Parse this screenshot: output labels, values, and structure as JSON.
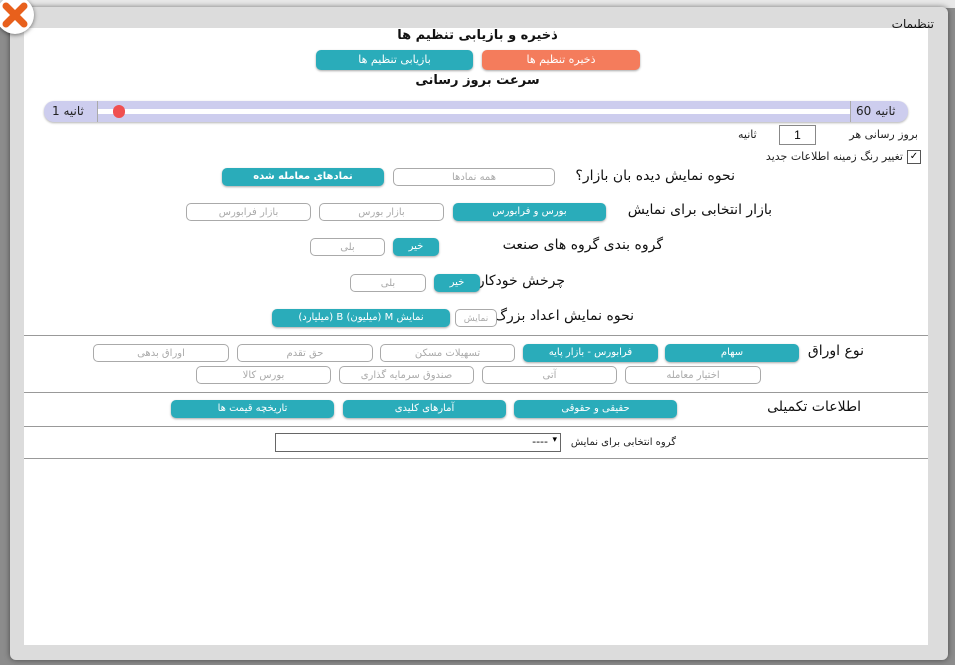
{
  "dialog": {
    "title": "تنظیمات"
  },
  "save_restore": {
    "heading": "ذخیره و بازیابی تنظیم ها",
    "save": "ذخیره تنظیم ها",
    "restore": "بازیابی تنظیم ها"
  },
  "refresh": {
    "heading": "سرعت بروز رسانی",
    "min_label": "ثانیه 1",
    "max_label": "ثانیه 60",
    "value_fraction": 0.02,
    "every_prefix": "بروز رسانی هر",
    "every_value": "1",
    "every_suffix": "ثانیه",
    "highlight_label": "تغییر رنگ زمینه اطلاعات جدید",
    "highlight_checked": true
  },
  "watch_mode": {
    "label": "نحوه نمایش دیده بان بازار؟",
    "options": [
      "همه نمادها",
      "نمادهای معامله شده"
    ],
    "selected": 1
  },
  "market": {
    "label": "بازار انتخابی برای نمایش",
    "options": [
      "بورس و فرابورس",
      "بازار بورس",
      "بازار فرابورس"
    ],
    "selected": 0
  },
  "grouping": {
    "label": "گروه بندی گروه های صنعت",
    "options": [
      "خیر",
      "بلی"
    ],
    "selected": 0
  },
  "autorotate": {
    "label": "چرخش خودکار",
    "options": [
      "خیر",
      "بلی"
    ],
    "selected": 0
  },
  "bignum": {
    "label": "نحوه نمایش اعداد بزرگ",
    "options": [
      "نمایش ساده",
      "نمایش M (میلیون) B (میلیارد)"
    ],
    "selected": 1
  },
  "security_type": {
    "label": "نوع اوراق",
    "options": [
      "سهام",
      "فرابورس - بازار پایه",
      "تسهیلات مسکن",
      "حق تقدم",
      "اوراق بدهی",
      "اختیار معامله",
      "آتی",
      "صندوق سرمایه گذاری",
      "بورس کالا"
    ],
    "selected": [
      0,
      1
    ]
  },
  "extra": {
    "label": "اطلاعات تکمیلی",
    "options": [
      "حقیقی و حقوقی",
      "آمارهای کلیدی",
      "تاریخچه قیمت ها"
    ]
  },
  "group_select": {
    "label": "گروه انتخابی برای نمایش",
    "value": "----"
  },
  "colors": {
    "teal": "#2aacba",
    "orange": "#f47c5c",
    "slider": "#cdcdee"
  }
}
